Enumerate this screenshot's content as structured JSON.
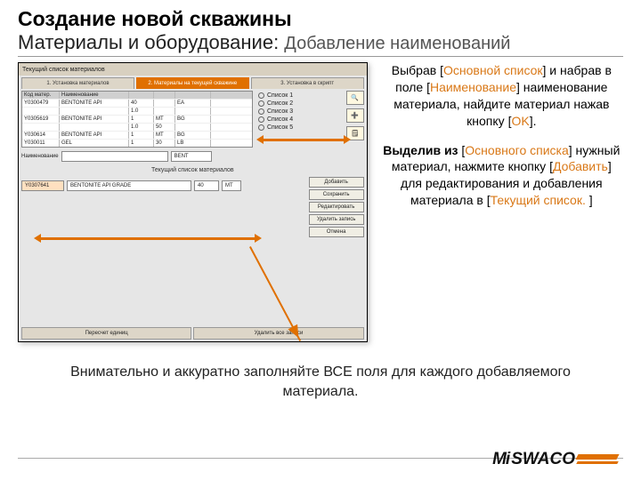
{
  "heading": {
    "line1": "Создание новой скважины",
    "line2": "Материалы и оборудование: ",
    "sub": "Добавление наименований"
  },
  "app": {
    "title": "Текущий список материалов",
    "tabs": [
      "1. Установка материалов",
      "2. Материалы на текущей скважине",
      "3. Установка в скрипт"
    ],
    "table": {
      "cols": [
        "Код матер.",
        "Наименование",
        "",
        "",
        ""
      ],
      "rows": [
        [
          "Y0300479",
          "BENTONITE API",
          "40",
          "",
          "EA"
        ],
        [
          "",
          "",
          "1.0",
          "",
          ""
        ],
        [
          "Y0305619",
          "BENTONITE API",
          "1",
          "MT",
          "BG"
        ],
        [
          "",
          "",
          "1.0",
          "50",
          ""
        ],
        [
          "Y030614",
          "BENTONITE API",
          "1",
          "MT",
          "BG"
        ],
        [
          "Y030011",
          "GEL",
          "1",
          "30",
          "LB"
        ]
      ]
    },
    "radios": [
      "Список 1",
      "Список 2",
      "Список 3",
      "Список 4",
      "Список 5"
    ],
    "form": {
      "name_label": "Наименование",
      "name_value": "",
      "code_value": "BENT"
    },
    "section_label": "Текущий список материалов",
    "edit": {
      "code": "Y0307641",
      "name": "BENTONITE API GRADE",
      "v1": "40",
      "v2": "MT"
    },
    "buttons": [
      "Добавить",
      "Сохранить",
      "Редактировать",
      "Удалить запись",
      "Отмена"
    ],
    "bottom_tabs": [
      "Пересчет единиц",
      "Удалить все записи"
    ]
  },
  "text": {
    "p1": {
      "a": "Выбрав ",
      "b": "Основной список",
      "c": " и набрав в поле ",
      "d": "Наименование",
      "e": " наименование материала, найдите материал нажав кнопку ",
      "f": "OK",
      "g": "."
    },
    "p2": {
      "a": "Выделив из ",
      "b": "Основного списка",
      "c": " нужный материал, нажмите кнопку ",
      "d": "Добавить",
      "e": " для редактирования и добавления материала в ",
      "f": "Текущий список. "
    }
  },
  "footnote": "Внимательно и аккуратно заполняйте ВСЕ поля для каждого добавляемого материала.",
  "logo": {
    "a": "Mi",
    "b": "SWACO"
  }
}
